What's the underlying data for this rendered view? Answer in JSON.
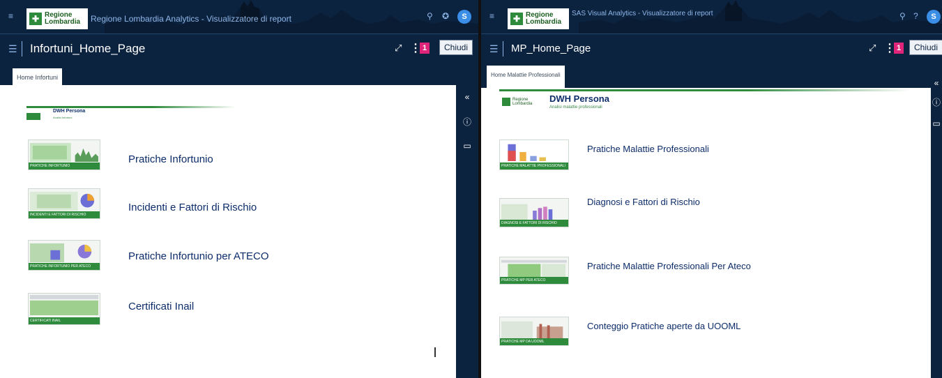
{
  "left": {
    "app_title": "Regione Lombardia Analytics - Visualizzatore di report",
    "brand": {
      "line1": "Regione",
      "line2": "Lombardia"
    },
    "user_initial": "S",
    "report_title": "Infortuni_Home_Page",
    "badge_count": "1",
    "close_label": "Chiudi",
    "tab_label": "Home Infortuni",
    "header": {
      "title": "DWH Persona",
      "subtitle": "Analisi Infortuni"
    },
    "reports": [
      {
        "label": "Pratiche Infortunio",
        "thumb_caption": "PRATICHE INFORTUNIO"
      },
      {
        "label": "Incidenti e Fattori di Rischio",
        "thumb_caption": "INCIDENTI E FATTORI DI RISCHIO"
      },
      {
        "label": "Pratiche Infortunio per ATECO",
        "thumb_caption": "PRATICHE INFORTUNIO PER ATECO"
      },
      {
        "label": "Certificati Inail",
        "thumb_caption": "CERTIFICATI INAIL"
      }
    ]
  },
  "right": {
    "app_title": "SAS Visual Analytics - Visualizzatore di report",
    "brand": {
      "line1": "Regione",
      "line2": "Lombardia"
    },
    "user_initial": "S",
    "report_title": "MP_Home_Page",
    "badge_count": "1",
    "close_label": "Chiudi",
    "tab_label": "Home Malattie Professionali",
    "header": {
      "title": "DWH Persona",
      "subtitle": "Analisi malattie professionali",
      "logo_line1": "Regione",
      "logo_line2": "Lombardia"
    },
    "reports": [
      {
        "label": "Pratiche Malattie Professionali",
        "thumb_caption": "PRATICHE MALATTIE PROFESSIONALI"
      },
      {
        "label": "Diagnosi e Fattori di Rischio",
        "thumb_caption": "DIAGNOSI E FATTORI DI RISCHIO"
      },
      {
        "label": "Pratiche Malattie Professionali Per Ateco",
        "thumb_caption": "PRATICHE MP PER ATECO"
      },
      {
        "label": "Conteggio Pratiche aperte da UOOML",
        "thumb_caption": "PRATICHE MP DA UOOML"
      }
    ]
  },
  "icons": {
    "hamburger": "hamburger-icon",
    "search": "search-icon",
    "help": "help-icon",
    "expand": "expand-icon",
    "more": "more-vertical-icon",
    "collapse": "collapse-left-icon",
    "info": "info-icon",
    "comment": "comment-icon"
  },
  "colors": {
    "navy": "#0c2340",
    "brand_green": "#2e8b3c",
    "link_blue": "#0c2c6a",
    "badge_pink": "#e0247a"
  }
}
